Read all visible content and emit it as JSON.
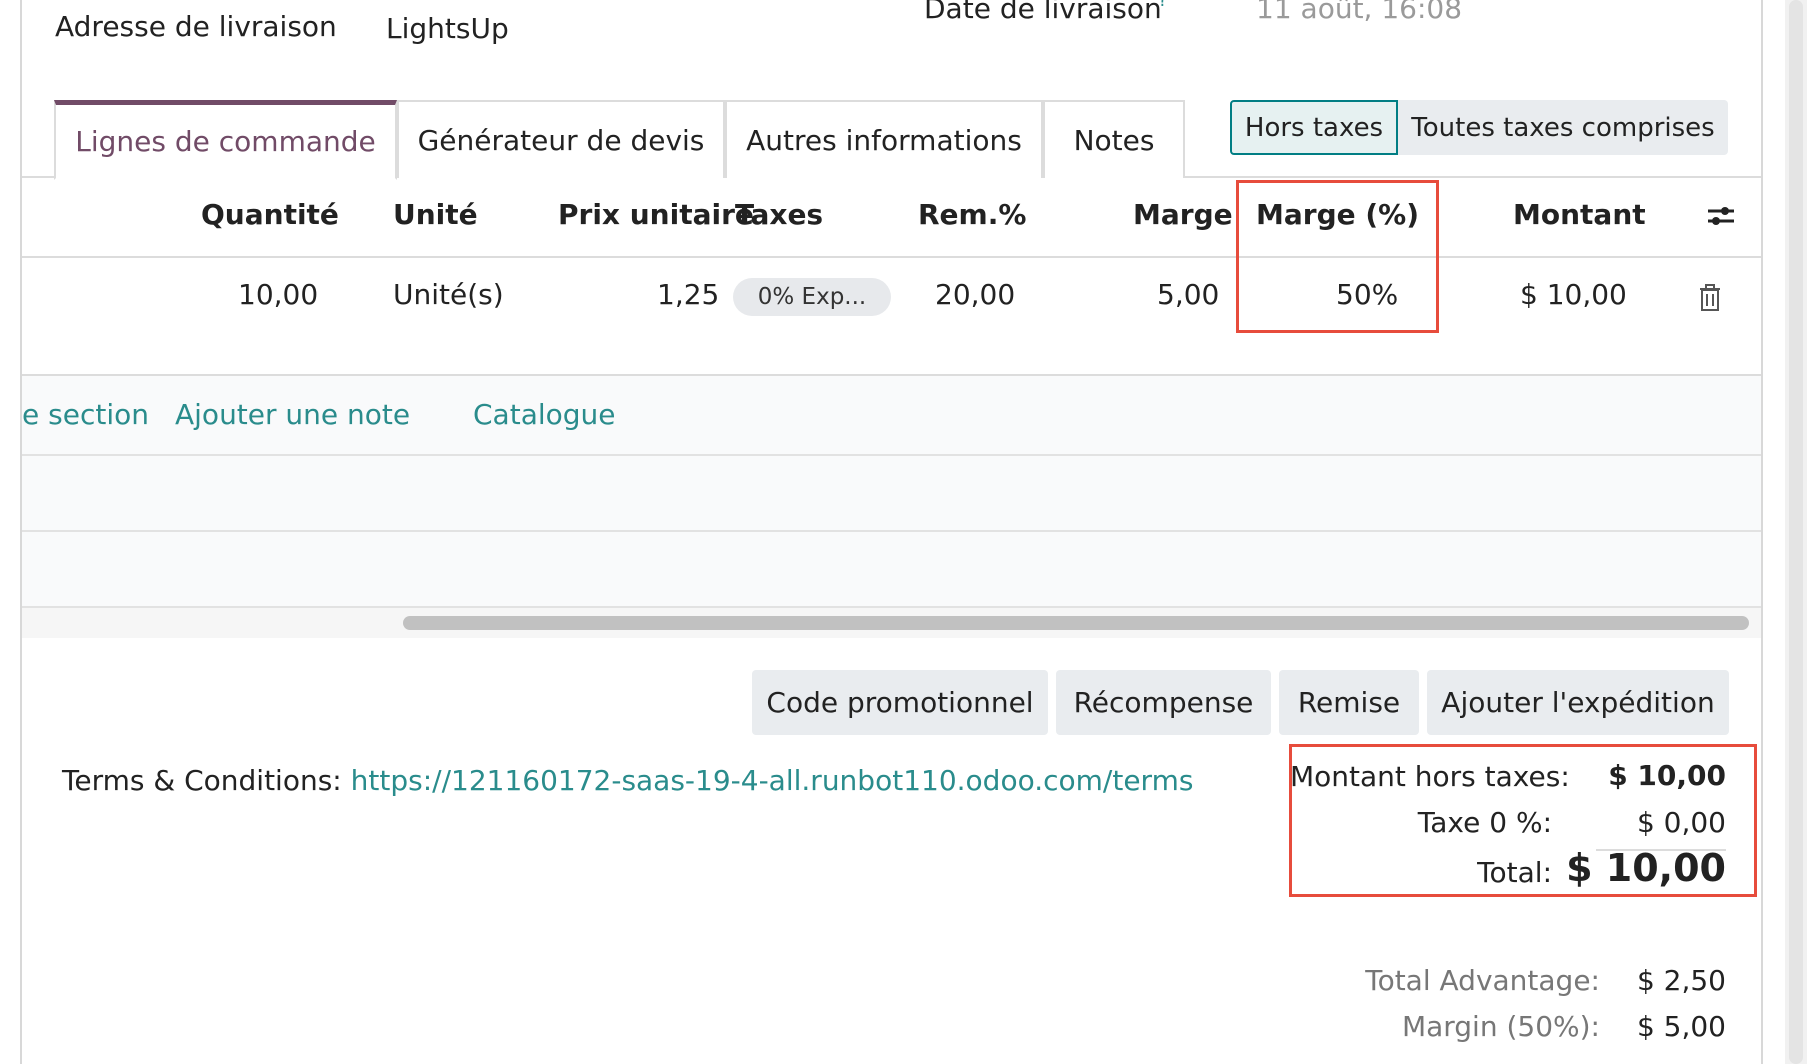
{
  "header": {
    "delivery_address_label": "Adresse de livraison",
    "delivery_address_value": "LightsUp",
    "delivery_date_label": "Date de livraison",
    "delivery_date_help": "?",
    "delivery_date_value": "11 août, 16:08"
  },
  "tabs": [
    {
      "label": "Lignes de commande",
      "active": true
    },
    {
      "label": "Générateur de devis",
      "active": false
    },
    {
      "label": "Autres informations",
      "active": false
    },
    {
      "label": "Notes",
      "active": false
    }
  ],
  "tax_toggle": {
    "excluded": "Hors taxes",
    "included": "Toutes taxes comprises",
    "selected": "Hors taxes"
  },
  "table": {
    "columns": {
      "quantity": "Quantité",
      "unit": "Unité",
      "unit_price": "Prix unitaire",
      "taxes": "Taxes",
      "discount": "Rem.%",
      "margin": "Marge",
      "margin_pct": "Marge (%)",
      "amount": "Montant"
    },
    "rows": [
      {
        "quantity": "10,00",
        "unit": "Unité(s)",
        "unit_price": "1,25",
        "taxes": "0% Exp...",
        "discount": "20,00",
        "margin": "5,00",
        "margin_pct": "50%",
        "amount": "$ 10,00"
      }
    ],
    "add_links": {
      "section": "e section",
      "note": "Ajouter une note",
      "catalog": "Catalogue"
    }
  },
  "buttons": {
    "promo_code": "Code promotionnel",
    "reward": "Récompense",
    "discount": "Remise",
    "add_shipping": "Ajouter l'expédition"
  },
  "terms": {
    "label": "Terms & Conditions:",
    "url": "https://121160172-saas-19-4-all.runbot110.odoo.com/terms"
  },
  "totals": {
    "untaxed_label": "Montant hors taxes:",
    "untaxed_value": "$ 10,00",
    "tax_label": "Taxe 0 %:",
    "tax_value": "$ 0,00",
    "total_label": "Total:",
    "total_value": "$ 10,00"
  },
  "advantages": {
    "total_advantage_label": "Total Advantage:",
    "total_advantage_value": "$ 2,50",
    "margin_label": "Margin (50%):",
    "margin_value": "$ 5,00"
  },
  "colors": {
    "accent": "#714b67",
    "link": "#2a8c8c",
    "highlight": "#e74c3c"
  },
  "icons": {
    "column_settings": "sliders-icon",
    "delete_row": "trash-icon"
  }
}
